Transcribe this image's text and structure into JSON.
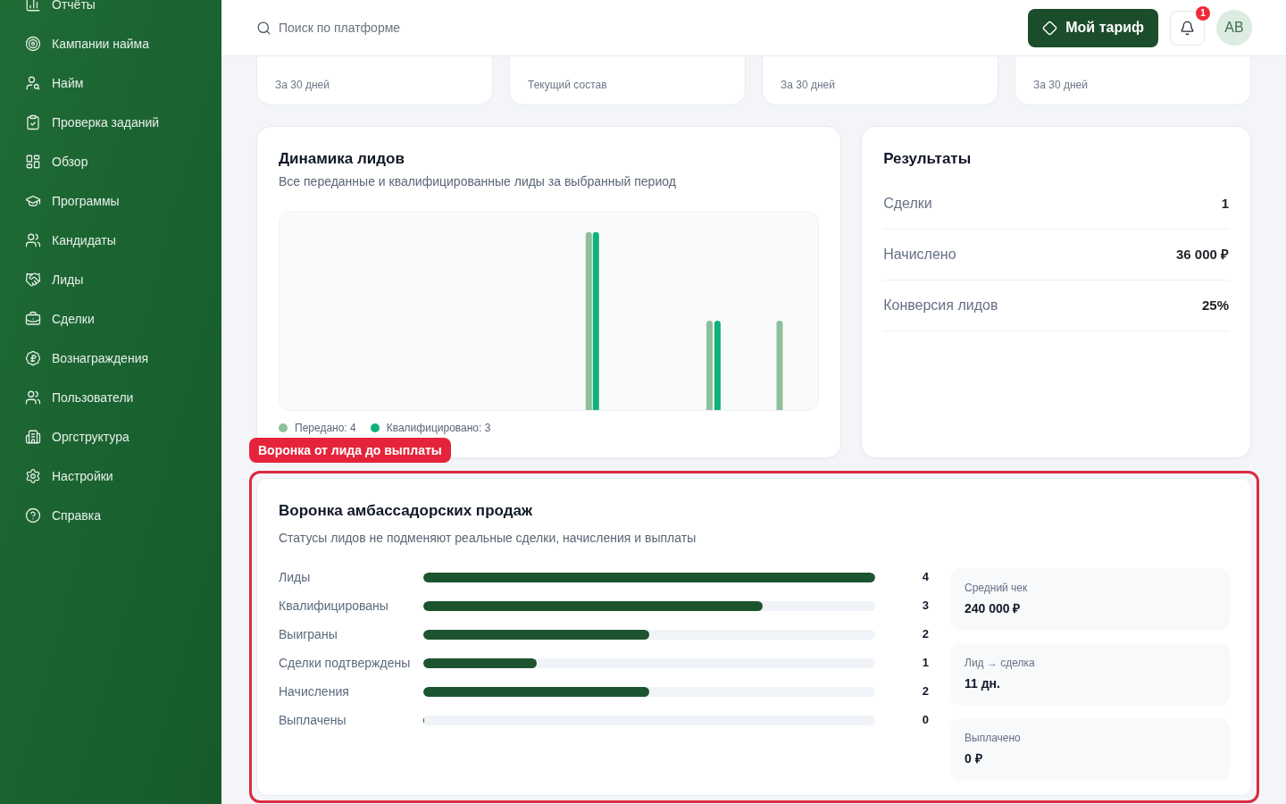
{
  "sidebar": {
    "items": [
      {
        "label": "Отчёты",
        "selected": false
      },
      {
        "label": "Кампании найма",
        "selected": false
      },
      {
        "label": "Найм",
        "selected": false
      },
      {
        "label": "Проверка заданий",
        "selected": false
      },
      {
        "label": "Обзор",
        "selected": false
      },
      {
        "label": "Программы",
        "selected": false
      },
      {
        "label": "Кандидаты",
        "selected": false
      },
      {
        "label": "Лиды",
        "selected": false
      },
      {
        "label": "Сделки",
        "selected": false
      },
      {
        "label": "Вознаграждения",
        "selected": false
      },
      {
        "label": "Пользователи",
        "selected": false
      },
      {
        "label": "Оргструктура",
        "selected": false
      },
      {
        "label": "Настройки",
        "selected": false
      },
      {
        "label": "Справка",
        "selected": false
      }
    ]
  },
  "header": {
    "search": {
      "placeholder": "Поиск по платформе"
    },
    "plan_button": "Мой тариф",
    "notifications": {
      "badge": "1"
    },
    "avatar": "АВ"
  },
  "stat_cards": [
    {
      "caption": "За 30 дней"
    },
    {
      "caption": "Текущий состав"
    },
    {
      "caption": "За 30 дней"
    },
    {
      "caption": "За 30 дней"
    }
  ],
  "lead_dynamics": {
    "title": "Динамика лидов",
    "subtitle": "Все переданные и квалифицированные лиды за выбранный период",
    "legend": [
      {
        "label": "Передано: 4",
        "color": "#8fbf9a"
      },
      {
        "label": "Квалифицировано: 3",
        "color": "#10b27a"
      }
    ]
  },
  "results": {
    "title": "Результаты",
    "rows": [
      {
        "label": "Сделки",
        "value": "1"
      },
      {
        "label": "Начислено",
        "value": "36 000 ₽"
      },
      {
        "label": "Конверсия лидов",
        "value": "25%"
      }
    ]
  },
  "annotation": {
    "label": "Воронка от лида до выплаты"
  },
  "funnel": {
    "title": "Воронка амбассадорских продаж",
    "subtitle": "Статусы лидов не подменяют реальные сделки, начисления и выплаты",
    "rows": [
      {
        "label": "Лиды",
        "count": "4",
        "level": 1
      },
      {
        "label": "Квалифицированы",
        "count": "3",
        "level": 0.75
      },
      {
        "label": "Выиграны",
        "count": "2",
        "level": 0.5
      },
      {
        "label": "Сделки подтверждены",
        "count": "1",
        "level": 0.25
      },
      {
        "label": "Начисления",
        "count": "2",
        "level": 0.5
      },
      {
        "label": "Выплачены",
        "count": "0",
        "level": 0
      }
    ],
    "stats": [
      {
        "label": "Средний чек",
        "value": "240 000 ₽"
      },
      {
        "label": "Лид → сделка",
        "value": "11 дн."
      },
      {
        "label": "Выплачено",
        "value": "0 ₽"
      }
    ]
  }
}
